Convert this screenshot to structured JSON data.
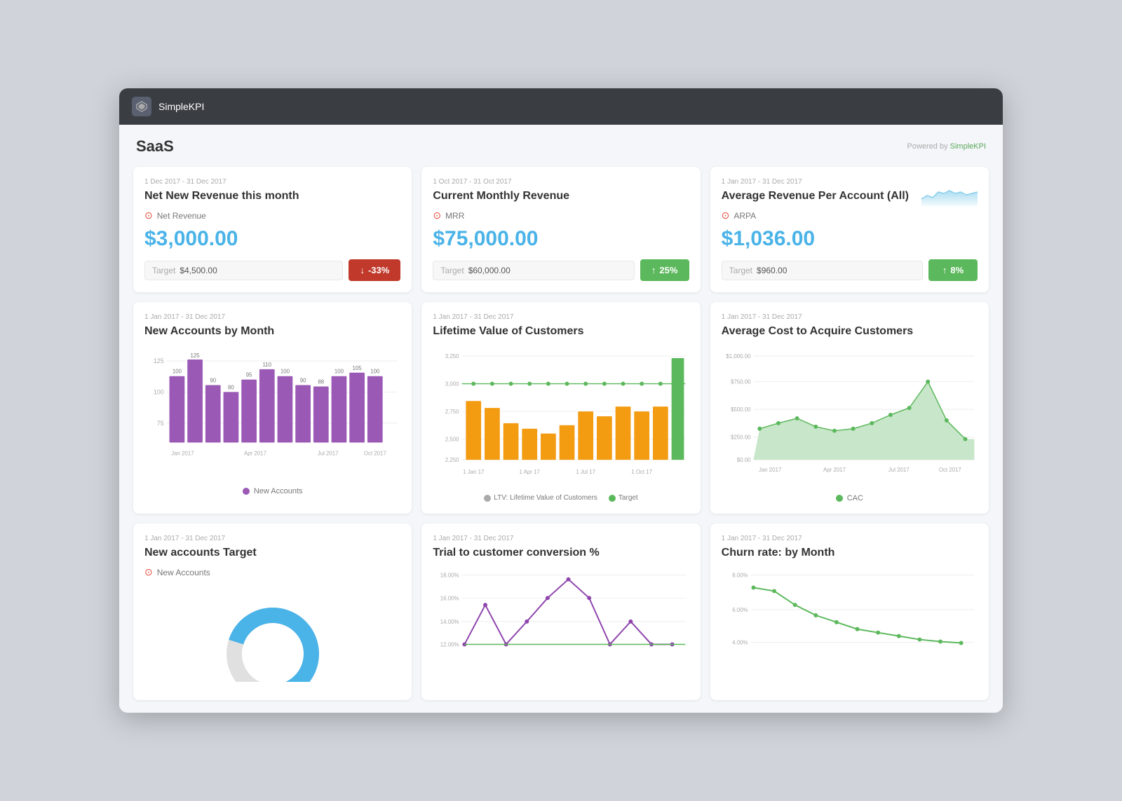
{
  "app": {
    "title": "SimpleKPI",
    "powered_by": "Powered by SimpleKPI"
  },
  "page": {
    "title": "SaaS"
  },
  "cards": {
    "net_new_revenue": {
      "date": "1 Dec 2017 - 31 Dec 2017",
      "title": "Net New Revenue this month",
      "kpi_label": "Net Revenue",
      "value": "$3,000.00",
      "target_label": "Target",
      "target_value": "$4,500.00",
      "badge": "-33%",
      "badge_type": "negative"
    },
    "current_monthly": {
      "date": "1 Oct 2017 - 31 Oct 2017",
      "title": "Current Monthly Revenue",
      "kpi_label": "MRR",
      "value": "$75,000.00",
      "target_label": "Target",
      "target_value": "$60,000.00",
      "badge": "25%",
      "badge_type": "positive"
    },
    "avg_revenue": {
      "date": "1 Jan 2017 - 31 Dec 2017",
      "title": "Average Revenue Per Account (All)",
      "kpi_label": "ARPA",
      "value": "$1,036.00",
      "target_label": "Target",
      "target_value": "$960.00",
      "badge": "8%",
      "badge_type": "positive"
    },
    "new_accounts": {
      "date": "1 Jan 2017 - 31 Dec 2017",
      "title": "New Accounts by Month",
      "legend_label": "New Accounts",
      "x_labels": [
        "Jan 2017",
        "Apr 2017",
        "Jul 2017",
        "Oct 2017"
      ],
      "y_labels": [
        "125",
        "100",
        "75"
      ],
      "bars": [
        100,
        125,
        90,
        80,
        95,
        110,
        100,
        90,
        88,
        100,
        105,
        100
      ]
    },
    "lifetime_value": {
      "date": "1 Jan 2017 - 31 Dec 2017",
      "title": "Lifetime Value of Customers",
      "legend_ltv": "LTV: Lifetime Value of Customers",
      "legend_target": "Target",
      "x_labels": [
        "1 Jan 17",
        "1 Apr 17",
        "1 Jul 17",
        "1 Oct 17"
      ],
      "y_labels": [
        "3,250",
        "3,000",
        "2,750",
        "2,500",
        "2,250"
      ]
    },
    "avg_cost": {
      "date": "1 Jan 2017 - 31 Dec 2017",
      "title": "Average Cost to Acquire Customers",
      "legend_label": "CAC",
      "x_labels": [
        "Jan 2017",
        "Apr 2017",
        "Jul 2017",
        "Oct 2017"
      ],
      "y_labels": [
        "$1,000.00",
        "$750.00",
        "$500.00",
        "$250.00",
        "$0.00"
      ]
    },
    "new_accounts_target": {
      "date": "1 Jan 2017 - 31 Dec 2017",
      "title": "New accounts Target",
      "kpi_label": "New Accounts"
    },
    "trial_conversion": {
      "date": "1 Jan 2017 - 31 Dec 2017",
      "title": "Trial to customer conversion %",
      "y_labels": [
        "18.00%",
        "16.00%",
        "14.00%",
        "12.00%"
      ]
    },
    "churn_rate": {
      "date": "1 Jan 2017 - 31 Dec 2017",
      "title": "Churn rate: by Month",
      "y_labels": [
        "8.00%",
        "6.00%",
        "4.00%"
      ]
    }
  }
}
